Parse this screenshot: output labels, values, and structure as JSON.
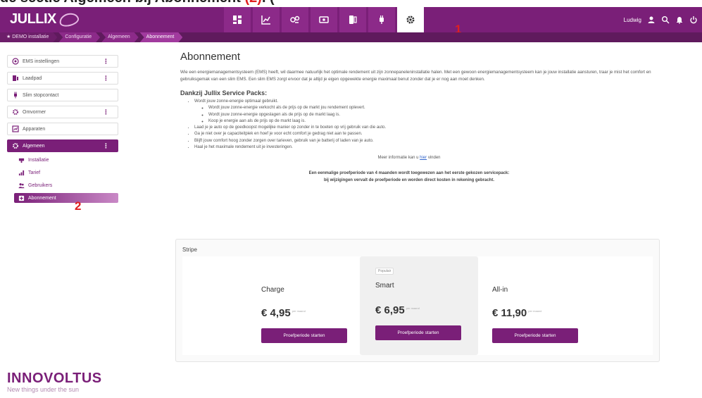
{
  "caption": {
    "prefix": "de sectie ",
    "bold1": "Algemeen",
    "mid": " bij ",
    "bold2": "Abonnement",
    "marker": " (2)",
    "suffix": ". ("
  },
  "app": {
    "logo": "JULLIX"
  },
  "nav": {
    "items": [
      {
        "icon": "dashboard-icon"
      },
      {
        "icon": "chart-icon"
      },
      {
        "icon": "flow-icon"
      },
      {
        "icon": "battery-icon"
      },
      {
        "icon": "phone-battery-icon"
      },
      {
        "icon": "plug-icon"
      },
      {
        "icon": "gear-icon",
        "active": true
      }
    ],
    "marker": "1"
  },
  "user": {
    "name": "Ludwig"
  },
  "breadcrumb": [
    "DEMO installatie",
    "Configuratie",
    "Algemeen",
    "Abonnement"
  ],
  "sidebar": {
    "items": [
      {
        "label": "EMS instellingen",
        "icon": "ems-icon",
        "menu": "⋮"
      },
      {
        "label": "Laadpad",
        "icon": "charger-icon",
        "menu": "⋮"
      },
      {
        "label": "Slim stopcontact",
        "icon": "plug-icon"
      },
      {
        "label": "Omvormer",
        "icon": "inverter-icon",
        "menu": "⋮"
      },
      {
        "label": "Apparaten",
        "icon": "devices-icon"
      },
      {
        "label": "Algemeen",
        "icon": "gear-icon",
        "menu": "⋮",
        "open": true
      }
    ],
    "subitems": [
      {
        "label": "Installatie",
        "icon": "installation-icon"
      },
      {
        "label": "Tarief",
        "icon": "tariff-icon"
      },
      {
        "label": "Gebruikers",
        "icon": "users-icon"
      },
      {
        "label": "Abonnement",
        "icon": "subscription-icon",
        "active": true
      }
    ],
    "marker": "2"
  },
  "brand": {
    "name": "INNOVOLTUS",
    "tagline": "New things under the sun"
  },
  "main": {
    "title": "Abonnement",
    "intro": "Wie een energiemanagementsysteem (EMS) heeft, wil daarmee natuurlijk het optimale rendement uit zijn zonnepaneleninstallatie halen. Met een gewoon energiemanagementsysteem kan je jouw installatie aansturen, traar je mist het comfort en gebruiksgemak van een slim EMS. Een slim EMS zorgt ervoor dat je altijd je eigen opgewekte energie maximaal benut zonder dat je er nog aan moet denken.",
    "packs_title": "Dankzij Jullix Service Packs:",
    "bullets": [
      "Wordt jouw zonne-energie optimaal gebruikt.",
      "Laad je je auto op de goedkoopst mogelijke manier op zonder in te boeten op vrij gebruik van die auto.",
      "Ga je niet over je capaciteitpiek en hoef je voor echt comfort je gedrag niet aan te passen.",
      "Blijft jouw comfort hoog zonder zorgen over tarieven, gebruik van je batterij of laden van je auto.",
      "Haal je het maximale rendement uit je investeringen."
    ],
    "subbullets": [
      "Wordt jouw zonne-energie verkocht als de prijs op de markt jou rendement oplevert.",
      "Wordt jouw zonne-energie opgeslagen als de prijs op de markt laag is.",
      "Koop je energie aan als de prijs op de markt laag is."
    ],
    "more_info_prefix": "Meer informatie kan u ",
    "more_info_link": "hier",
    "more_info_suffix": " vinden",
    "trial_line1": "Een eenmalige proefperiode van 4 maanden wordt toegewezen aan het eerste gekozen servicepack:",
    "trial_line2": "bij wijzigingen vervalt de proefperiode en worden direct kosten in rekening gebracht."
  },
  "stripe": {
    "label": "Stripe",
    "plans": [
      {
        "name": "Charge",
        "price": "€ 4,95",
        "per": "per maand",
        "button": "Proefperiode starten"
      },
      {
        "name": "Smart",
        "price": "€ 6,95",
        "per": "per maand",
        "button": "Proefperiode starten",
        "badge": "Populair"
      },
      {
        "name": "All-in",
        "price": "€ 11,90",
        "per": "per maand",
        "button": "Proefperiode starten"
      }
    ]
  },
  "colors": {
    "brand": "#7a1f78",
    "brand_dark": "#5f1a5d",
    "marker": "#e02020"
  }
}
